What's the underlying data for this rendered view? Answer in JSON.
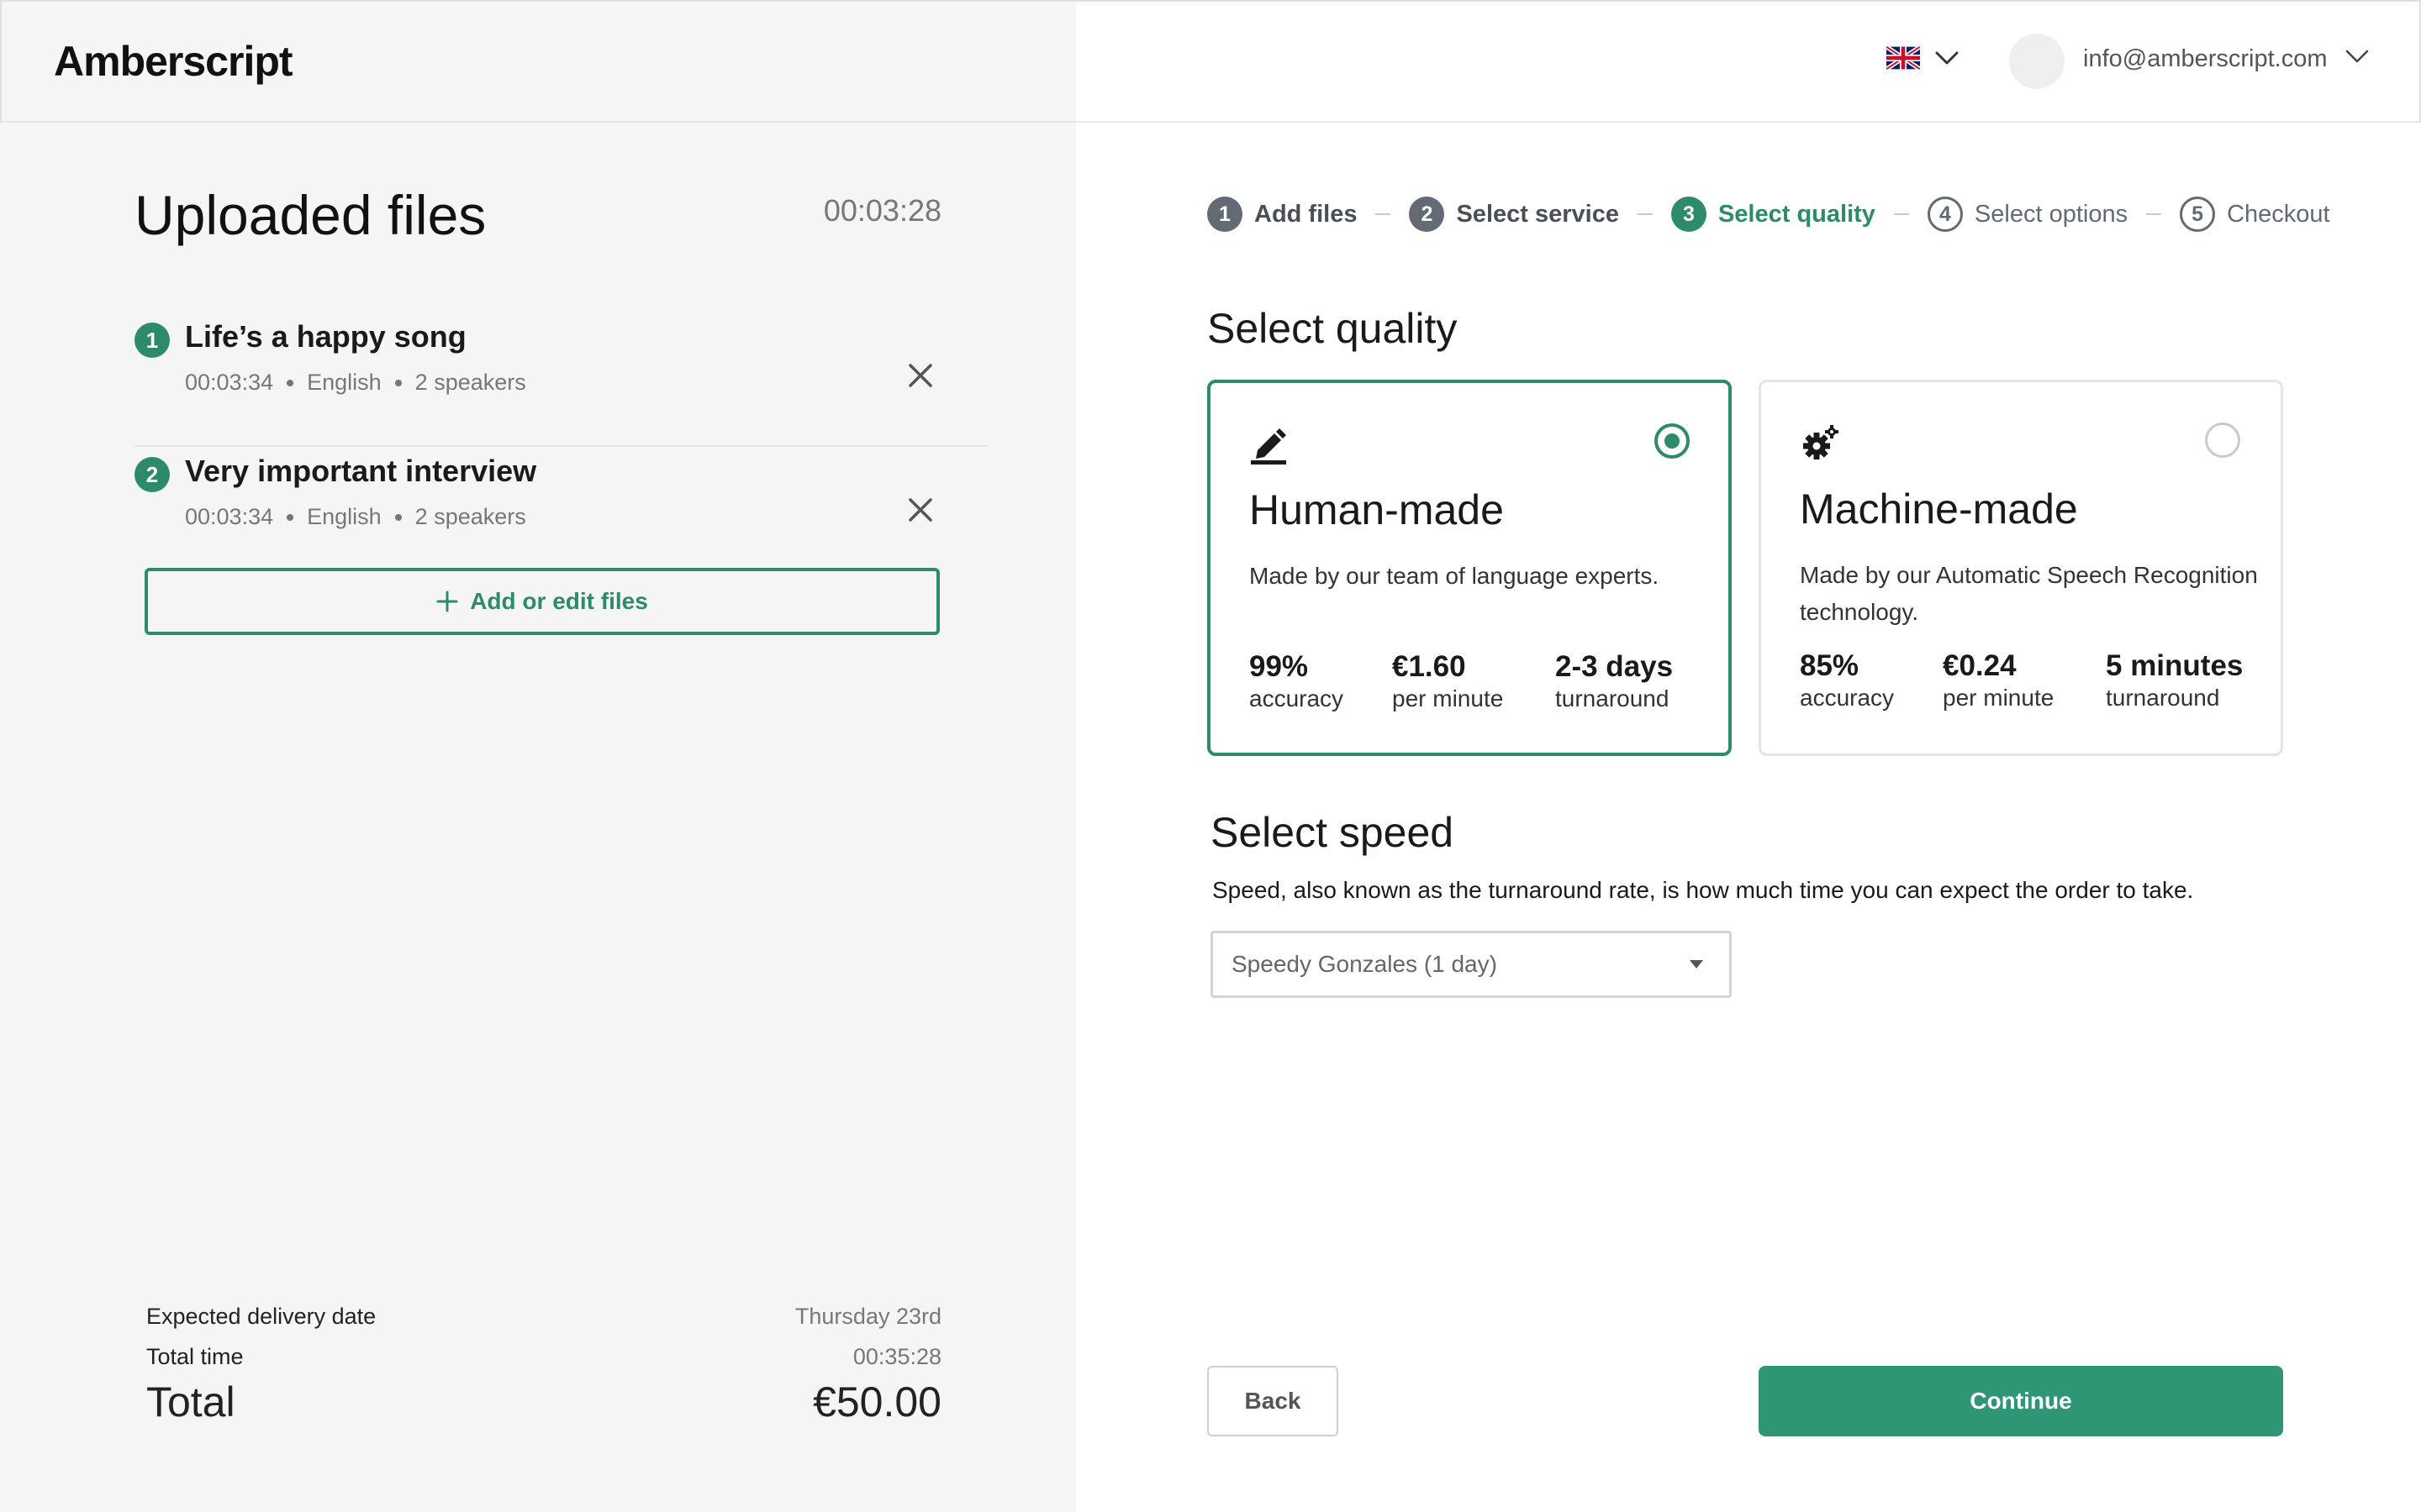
{
  "app": {
    "logo": "Amberscript"
  },
  "header": {
    "language_flag": "uk-flag-icon",
    "email": "info@amberscript.com"
  },
  "uploaded": {
    "title": "Uploaded files",
    "total_duration": "00:03:28",
    "files": [
      {
        "num": "1",
        "name": "Life’s a happy song",
        "duration": "00:03:34",
        "language": "English",
        "speakers": "2 speakers"
      },
      {
        "num": "2",
        "name": "Very important interview",
        "duration": "00:03:34",
        "language": "English",
        "speakers": "2 speakers"
      }
    ],
    "add_button": "Add or edit files"
  },
  "summary": {
    "delivery_label": "Expected delivery date",
    "delivery_value": "Thursday 23rd",
    "total_time_label": "Total time",
    "total_time_value": "00:35:28",
    "total_label": "Total",
    "total_value": "€50.00"
  },
  "stepper": [
    {
      "num": "1",
      "label": "Add files",
      "state": "done"
    },
    {
      "num": "2",
      "label": "Select service",
      "state": "done"
    },
    {
      "num": "3",
      "label": "Select quality",
      "state": "active"
    },
    {
      "num": "4",
      "label": "Select options",
      "state": "todo"
    },
    {
      "num": "5",
      "label": "Checkout",
      "state": "todo"
    }
  ],
  "quality": {
    "title": "Select quality",
    "options": [
      {
        "icon": "pencil-icon",
        "title": "Human-made",
        "description": "Made by our team of language experts.",
        "selected": true,
        "stats": [
          {
            "value": "99%",
            "label": "accuracy"
          },
          {
            "value": "€1.60",
            "label": "per minute"
          },
          {
            "value": "2-3 days",
            "label": "turnaround"
          }
        ]
      },
      {
        "icon": "gears-icon",
        "title": "Machine-made",
        "description": "Made by our Automatic Speech Recognition technology.",
        "selected": false,
        "stats": [
          {
            "value": "85%",
            "label": "accuracy"
          },
          {
            "value": "€0.24",
            "label": "per minute"
          },
          {
            "value": "5 minutes",
            "label": "turnaround"
          }
        ]
      }
    ]
  },
  "speed": {
    "title": "Select speed",
    "description": "Speed, also known as the turnaround rate, is how much time you can expect the order to take.",
    "selected": "Speedy Gonzales (1 day)"
  },
  "footer": {
    "back": "Back",
    "continue": "Continue"
  },
  "colors": {
    "accent": "#2e8b6a",
    "continue_bg": "#2e9675",
    "left_bg": "#f5f5f5"
  }
}
